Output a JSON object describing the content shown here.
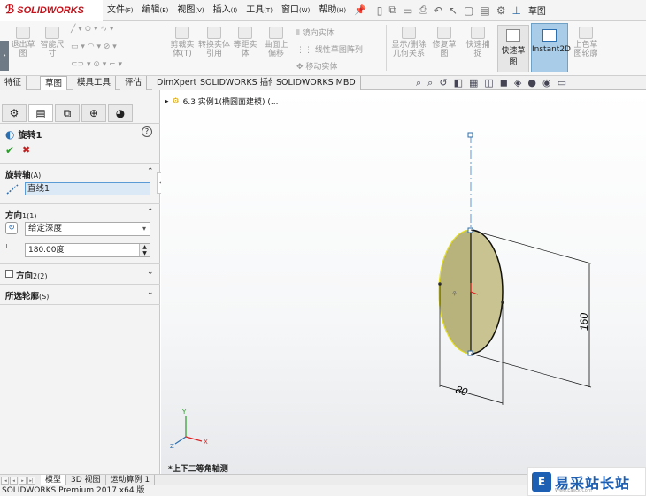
{
  "app": {
    "brand": "SOLIDWORKS",
    "menu": [
      {
        "label": "文件",
        "key": "(F)"
      },
      {
        "label": "编辑",
        "key": "(E)"
      },
      {
        "label": "视图",
        "key": "(V)"
      },
      {
        "label": "插入",
        "key": "(I)"
      },
      {
        "label": "工具",
        "key": "(T)"
      },
      {
        "label": "窗口",
        "key": "(W)"
      },
      {
        "label": "帮助",
        "key": "(H)"
      }
    ],
    "sketch_label": "草图"
  },
  "command_manager": {
    "exit_sketch": "退出草图",
    "smart_dimension": "智能尺寸",
    "cut_entities": "剪裁实体(T)",
    "convert_entities": "转换实体引用",
    "offset_entities": "等距实体",
    "offset_on_surface": "曲面上偏移",
    "mirror_entities": "镜向实体",
    "linear_pattern": "线性草图阵列",
    "move_entities": "移动实体",
    "display_relations": "显示/删除几何关系",
    "repair_sketch": "修复草图",
    "quick_snaps": "快速捕捉",
    "rapid_sketch": "快速草图",
    "instant2d": "Instant2D",
    "shaded_sketch": "上色草图轮廓"
  },
  "tabs": [
    "特征",
    "草图",
    "模具工具",
    "评估",
    "DimXpert",
    "SOLIDWORKS 插件",
    "SOLIDWORKS MBD"
  ],
  "active_tab": "草图",
  "property_manager": {
    "title": "旋转1",
    "axis_group": {
      "label": "旋转轴",
      "key": "(A)",
      "value": "直线1"
    },
    "direction1": {
      "label": "方向",
      "key": "1(1)",
      "end_condition": "给定深度",
      "angle": "180.00度"
    },
    "direction2": {
      "label": "方向",
      "key": "2(2)"
    },
    "contours": {
      "label": "所选轮廓",
      "key": "(S)"
    }
  },
  "tree": {
    "node": "6.3 实例1(椭圆面建模) (..."
  },
  "drawing": {
    "dim_width": "80",
    "dim_height": "160"
  },
  "view_name": "*上下二等角轴测",
  "bottom_tabs": [
    "模型",
    "3D 视图",
    "运动算例 1"
  ],
  "status": "SOLIDWORKS Premium 2017 x64 版",
  "watermark": {
    "text": "易采站长站",
    "sub": "Www.Easck.Com"
  }
}
